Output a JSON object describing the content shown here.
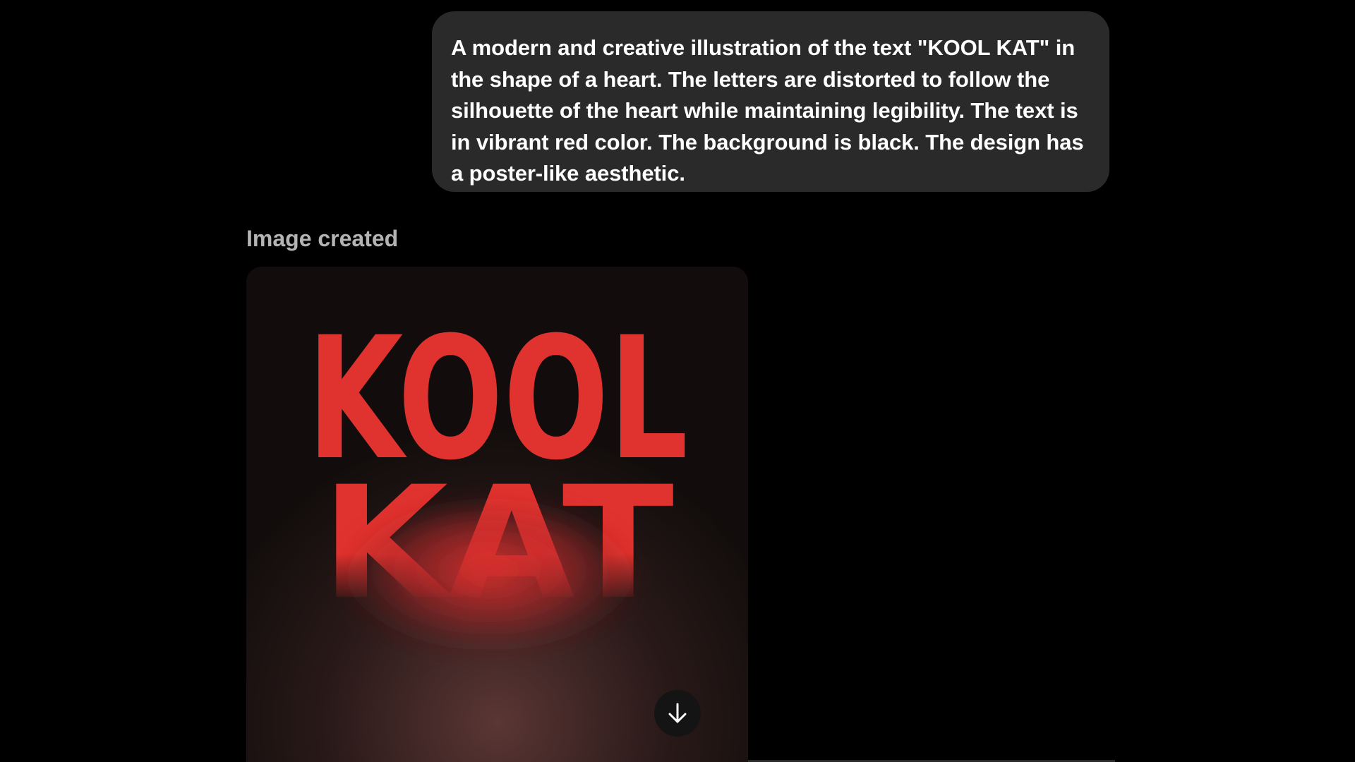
{
  "conversation": {
    "user_message": "A modern and creative illustration of the text \"KOOL KAT\" in the shape of a heart. The letters are distorted to follow the silhouette of the heart while maintaining legibility. The text is in vibrant red color. The background is black. The design has a poster-like aesthetic.",
    "status_label": "Image created"
  },
  "generated_image": {
    "text_line_1": "KOOL",
    "text_line_2": "KAT",
    "text_color": "#e0322e",
    "background_color": "#120d0c"
  },
  "actions": {
    "download_icon": "arrow-down-icon"
  },
  "colors": {
    "page_background": "#000000",
    "bubble_background": "#2a2a2a",
    "status_label": "#b4b4b4"
  }
}
